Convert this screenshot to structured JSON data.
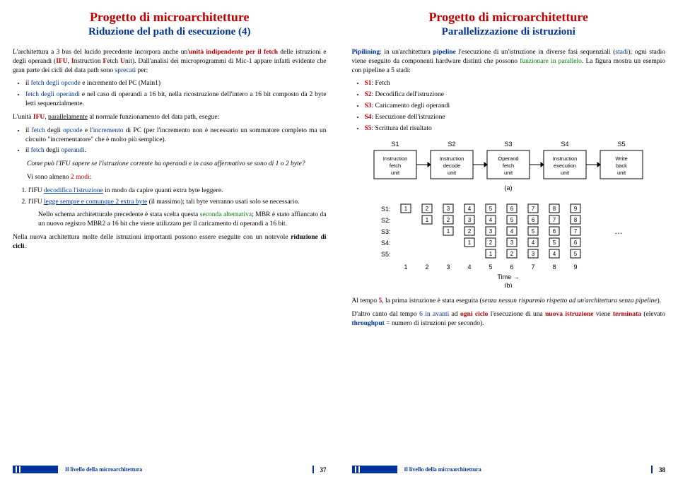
{
  "left": {
    "title": "Progetto di microarchitetture",
    "subtitle": "Riduzione del path di esecuzione (4)",
    "p1a": "L'architettura a 3 bus del lucido precedente incorpora anche un'",
    "p1b": "unità indipendente per il fetch",
    "p1c": " delle istruzioni e degli operandi (",
    "p1d": "IFU",
    "p1e": ", ",
    "p1f": "I",
    "p1g": "nstruction ",
    "p1h": "F",
    "p1i": "etch ",
    "p1j": "U",
    "p1k": "nit). Dall'analisi dei microprogrammi di Mic-1 appare infatti evidente che gran parte dei cicli del data path sono ",
    "p1l": "sprecati",
    "p1m": " per:",
    "li1a": "il ",
    "li1b": "fetch degli opcode",
    "li1c": " e incremento del PC (Main1)",
    "li2a": "fetch degli operandi",
    "li2b": " e nel caso di operandi a 16 bit, nella ricostruzione dell'intero a 16 bit composto da 2 byte letti sequenzialmente.",
    "p2a": "L'unità ",
    "p2b": "IFU",
    "p2c": ", ",
    "p2d": "parallelamente",
    "p2e": " al normale funzionamento del data path, esegue:",
    "li3a": "il ",
    "li3b": "fetch",
    "li3c": " degli ",
    "li3d": "opcode",
    "li3e": " e l'",
    "li3f": "incremento",
    "li3g": " di PC (per l'incremento non è necessario un sommatore completo ma un circuito \"incrementatore\" che è molto più semplice).",
    "li4a": "il ",
    "li4b": "fetch",
    "li4c": " degli ",
    "li4d": "operandi",
    "li4e": ".",
    "p3": "Come può l'IFU sapere se l'istruzione corrente ha operandi e in caso affermativo se sono di 1 o 2 byte?",
    "p4a": "Vi sono almeno ",
    "p4b": "2 modi",
    "p4c": ":",
    "ol1a": "l'IFU ",
    "ol1b": "decodifica l'istruzione",
    "ol1c": " in modo da capire quanti extra byte leggere.",
    "ol2a": "l'IFU ",
    "ol2b": "legge sempre e comunque 2 extra byte",
    "ol2c": " (il massimo); tali byte verranno usati solo se necessario.",
    "p5a": "Nello schema architetturale precedente è stata scelta questa ",
    "p5b": "seconda alternativa",
    "p5c": "; MBR è stato affiancato da un nuovo registro MBR2 a 16 bit che viene utilizzato per il caricamento di operandi a 16 bit.",
    "p6a": "Nella nuova architettura molte delle istruzioni importanti possono essere eseguite con un notevole ",
    "p6b": "riduzione di cicli",
    "p6c": ".",
    "footer": "Il livello della microarchitettura",
    "pagenum": "37"
  },
  "right": {
    "title": "Progetto di microarchitetture",
    "subtitle": "Parallelizzazione di istruzioni",
    "p1a": "Pipilining",
    "p1b": ": in un'architettura ",
    "p1c": "pipeline",
    "p1d": " l'esecuzione di un'istruzione in diverse fasi sequenziali (",
    "p1e": "stadi",
    "p1f": "); ogni stadio viene eseguito da componenti hardware distinti che possono ",
    "p1g": "funzionare in parallelo",
    "p1h": ". La figura mostra un esempio con pipeline a 5 stadi:",
    "s1a": "S1",
    "s1b": ": Fetch",
    "s2a": "S2",
    "s2b": ": Decodifica dell'istruzione",
    "s3a": "S3",
    "s3b": ": Caricamento degli operandi",
    "s4a": "S4",
    "s4b": ": Esecuzione dell'istruzione",
    "s5a": "S5",
    "s5b": ": Scrittura del risultato",
    "diagram_a": {
      "cols": [
        "S1",
        "S2",
        "S3",
        "S4",
        "S5"
      ],
      "boxes": [
        "Instruction fetch unit",
        "Instruction decode unit",
        "Operand fetch unit",
        "Instruction execution unit",
        "Write back unit"
      ],
      "label": "(a)"
    },
    "diagram_b": {
      "rows": [
        "S1:",
        "S2:",
        "S3:",
        "S4:",
        "S5:"
      ],
      "timescale": [
        "1",
        "2",
        "3",
        "4",
        "5",
        "6",
        "7",
        "8",
        "9"
      ],
      "timelabel": "Time",
      "arrow": "→",
      "dots": "…",
      "label": "(b)"
    },
    "p2a": "Al tempo ",
    "p2b": "5",
    "p2c": ", la prima istruzione è stata eseguita (",
    "p2d": "senza nessun risparmio rispetto ad un'architettura senza pipeline",
    "p2e": ").",
    "p3a": "D'altro canto dal tempo ",
    "p3b": "6 in avanti",
    "p3c": " ad ",
    "p3d": "ogni ciclo",
    "p3e": " l'esecuzione di una ",
    "p3f": "nuova istruzione",
    "p3g": " viene ",
    "p3h": "terminata",
    "p3i": " (elevato ",
    "p3j": "throughput",
    "p3k": " = numero di istruzioni per secondo).",
    "footer": "Il livello della microarchitettura",
    "pagenum": "38"
  }
}
